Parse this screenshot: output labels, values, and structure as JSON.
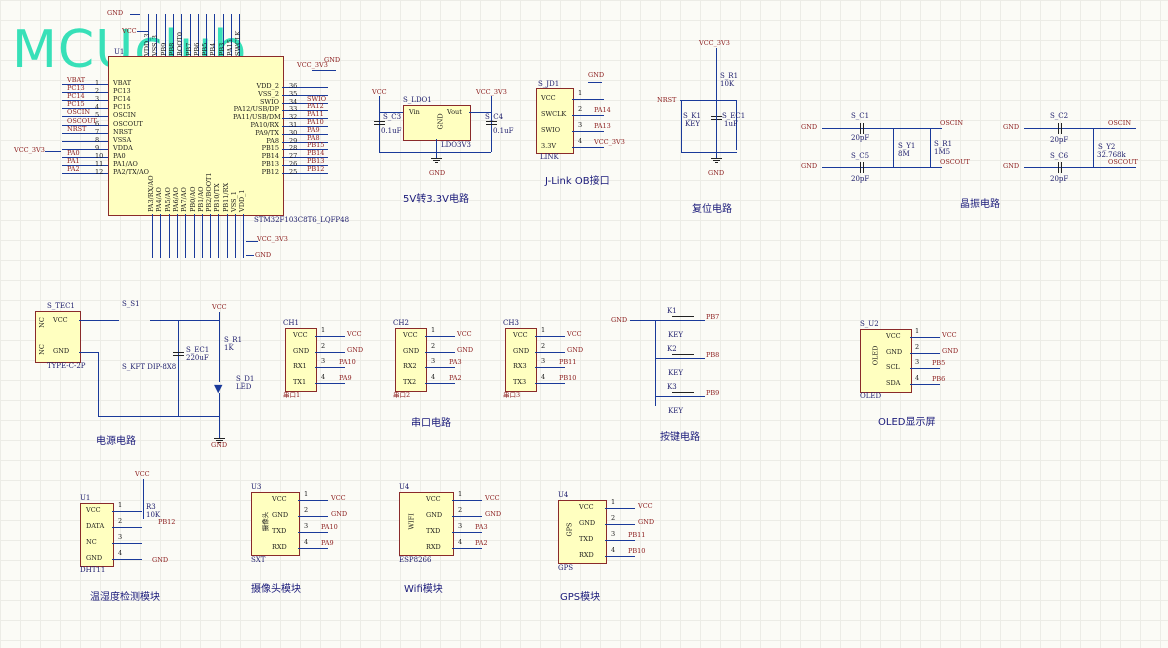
{
  "logo": "MCUclub",
  "mcu": {
    "ref": "U1",
    "part": "STM32F103C8T6_LQFP48",
    "left_pins": [
      {
        "num": "1",
        "name": "VBAT",
        "net": "VBAT"
      },
      {
        "num": "2",
        "name": "PC13",
        "net": "PC13"
      },
      {
        "num": "3",
        "name": "PC14",
        "net": "PC14"
      },
      {
        "num": "4",
        "name": "PC15",
        "net": "PC15"
      },
      {
        "num": "5",
        "name": "OSCIN",
        "net": "OSCIN"
      },
      {
        "num": "6",
        "name": "OSCOUT",
        "net": "OSCOUT"
      },
      {
        "num": "7",
        "name": "NRST",
        "net": "NRST"
      },
      {
        "num": "8",
        "name": "VSSA",
        "net": ""
      },
      {
        "num": "9",
        "name": "VDDA",
        "net": ""
      },
      {
        "num": "10",
        "name": "PA0",
        "net": "PA0"
      },
      {
        "num": "11",
        "name": "PA1/AO",
        "net": "PA1"
      },
      {
        "num": "12",
        "name": "PA2/TX/AO",
        "net": "PA2"
      }
    ],
    "right_pins": [
      {
        "num": "36",
        "name": "VDD_2",
        "net": ""
      },
      {
        "num": "35",
        "name": "VSS_2",
        "net": ""
      },
      {
        "num": "34",
        "name": "SWIO",
        "net": "SWIO"
      },
      {
        "num": "33",
        "name": "PA12/USB/DP",
        "net": "PA12"
      },
      {
        "num": "32",
        "name": "PA11/USB/DM",
        "net": "PA11"
      },
      {
        "num": "31",
        "name": "PA10/RX",
        "net": "PA10"
      },
      {
        "num": "30",
        "name": "PA9/TX",
        "net": "PA9"
      },
      {
        "num": "29",
        "name": "PA8",
        "net": "PA8"
      },
      {
        "num": "28",
        "name": "PB15",
        "net": "PB15"
      },
      {
        "num": "27",
        "name": "PB14",
        "net": "PB14"
      },
      {
        "num": "26",
        "name": "PB13",
        "net": "PB13"
      },
      {
        "num": "25",
        "name": "PB12",
        "net": "PB12"
      }
    ],
    "bottom_pins": [
      "PA3/RX/AO",
      "PA4/AO",
      "PA5/AO",
      "PA6/AO",
      "PA7/AO",
      "PB0/AO",
      "PB1/AO",
      "PB2/BOOT1",
      "PB10/TX",
      "PB11/RX",
      "VSS_1",
      "VDD_1"
    ],
    "top_pins": [
      "VDD_3",
      "VSS_3",
      "PB9",
      "PB8",
      "BOOT0",
      "PB7",
      "PB6",
      "PB5",
      "PB4",
      "PB3",
      "PA15",
      "SWCLK"
    ],
    "vcc_label": "VCC_3V3",
    "gnd_label": "GND",
    "vcc_left": "VCC_3V3"
  },
  "sections": {
    "ldo": {
      "caption": "5V转3.3V电路",
      "ref": "S_LDO1",
      "part": "LDO3V3",
      "vin": "Vin",
      "vout": "Vout",
      "gnd": "GND",
      "c3": "S_C3",
      "c3v": "0.1uF",
      "c4": "S_C4",
      "c4v": "0.1uF",
      "vcc": "VCC",
      "vcc33": "VCC_3V3",
      "gnd_label": "GND"
    },
    "jlink": {
      "caption": "J-Link OB接口",
      "ref": "S_JD1",
      "pins": [
        "VCC",
        "SWCLK",
        "SWIO",
        "3.3V"
      ],
      "nums": [
        "1",
        "2",
        "3",
        "4"
      ],
      "nets": [
        "",
        "PA14",
        "PA13",
        "VCC_3V3"
      ],
      "label": "LINK",
      "gnd": "GND"
    },
    "reset": {
      "caption": "复位电路",
      "vcc": "VCC_3V3",
      "r": "S_R1",
      "rv": "10K",
      "nrst": "NRST",
      "k": "S_K1",
      "kv": "KEY",
      "c": "S_EC1",
      "cv": "1uF",
      "gnd": "GND"
    },
    "crystal1": {
      "c1": "S_C1",
      "c1v": "20pF",
      "c5": "S_C5",
      "c5v": "20pF",
      "y": "S_Y1",
      "yv": "8M",
      "r": "S_R1",
      "rv": "1M5",
      "in": "OSCIN",
      "out": "OSCOUT",
      "gnd": "GND"
    },
    "crystal2": {
      "c2": "S_C2",
      "c2v": "20pF",
      "c6": "S_C6",
      "c6v": "20pF",
      "y": "S_Y2",
      "yv": "32.768k",
      "in": "OSCIN",
      "out": "OSCOUT",
      "gnd": "GND"
    },
    "crystal_caption": "晶振电路",
    "power": {
      "caption": "电源电路",
      "tec": "S_TEC1",
      "type": "TYPE-C-2P",
      "nc": "NC",
      "vccpin": "VCC",
      "gndpin": "GND",
      "sw": "S_S1",
      "swpart": "S_KFT DIP-8X8",
      "ec": "S_EC1",
      "ecv": "220uF",
      "r": "S_R1",
      "rv": "1K",
      "led": "S_D1",
      "ledv": "LED",
      "vcc": "VCC",
      "gnd": "GND"
    },
    "uart": {
      "caption": "串口电路",
      "blocks": [
        {
          "ref": "CH1",
          "label": "串口1",
          "pins": [
            "VCC",
            "GND",
            "RX1",
            "TX1"
          ],
          "nets": [
            "VCC",
            "GND",
            "PA10",
            "PA9"
          ]
        },
        {
          "ref": "CH2",
          "label": "串口2",
          "pins": [
            "VCC",
            "GND",
            "RX2",
            "TX2"
          ],
          "nets": [
            "VCC",
            "GND",
            "PA3",
            "PA2"
          ]
        },
        {
          "ref": "CH3",
          "label": "串口3",
          "pins": [
            "VCC",
            "GND",
            "RX3",
            "TX3"
          ],
          "nets": [
            "VCC",
            "GND",
            "PB11",
            "PB10"
          ]
        }
      ]
    },
    "keys": {
      "caption": "按键电路",
      "gnd": "GND",
      "items": [
        {
          "ref": "K1",
          "v": "KEY",
          "net": "PB7"
        },
        {
          "ref": "K2",
          "v": "KEY",
          "net": "PB8"
        },
        {
          "ref": "K3",
          "v": "KEY",
          "net": "PB9"
        }
      ]
    },
    "oled": {
      "caption": "OLED显示屏",
      "ref": "S_U2",
      "label": "OLED",
      "body": "OLED",
      "pins": [
        "VCC",
        "GND",
        "SCL",
        "SDA"
      ],
      "nets": [
        "VCC",
        "GND",
        "PB5",
        "PB6"
      ]
    },
    "dht": {
      "caption": "温湿度检测模块",
      "ref": "U1",
      "label": "DHT11",
      "pins": [
        "VCC",
        "DATA",
        "NC",
        "GND"
      ],
      "nets": [
        "",
        "PB12",
        "",
        ""
      ],
      "r": "R3",
      "rv": "10K",
      "vcc": "VCC",
      "gnd": "GND"
    },
    "cam": {
      "caption": "摄像头模块",
      "ref": "U3",
      "label": "SXT",
      "body": "摄像头",
      "pins": [
        "VCC",
        "GND",
        "TXD",
        "RXD"
      ],
      "nets": [
        "VCC",
        "GND",
        "PA10",
        "PA9"
      ]
    },
    "wifi": {
      "caption": "Wifi模块",
      "ref": "U4",
      "label": "ESP8266",
      "body": "WIFI",
      "pins": [
        "VCC",
        "GND",
        "TXD",
        "RXD"
      ],
      "nets": [
        "VCC",
        "GND",
        "PA3",
        "PA2"
      ]
    },
    "gps": {
      "caption": "GPS模块",
      "ref": "U4",
      "label": "GPS",
      "body": "GPS",
      "pins": [
        "VCC",
        "GND",
        "TXD",
        "RXD"
      ],
      "nets": [
        "VCC",
        "GND",
        "PB11",
        "PB10"
      ]
    }
  }
}
